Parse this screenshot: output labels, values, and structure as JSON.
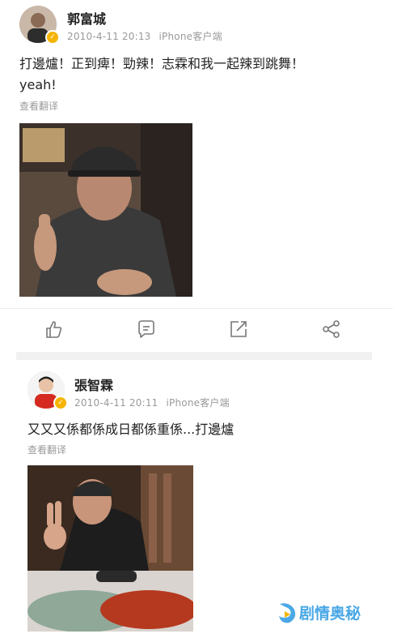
{
  "post1": {
    "author": "郭富城",
    "timestamp": "2010-4-11 20:13",
    "source": "iPhone客户端",
    "text_line1": "打邊爐！正到痺！勁辣！志霖和我一起辣到跳舞！",
    "text_line2": "yeah!",
    "translate": "查看翻译",
    "photo_icon": "photo-selfie-thumbs-up"
  },
  "toolbar": {
    "like_icon": "thumbs-up-icon",
    "comment_icon": "comment-icon",
    "repost_icon": "repost-icon",
    "share_icon": "share-icon"
  },
  "post2": {
    "author": "張智霖",
    "timestamp": "2010-4-11 20:11",
    "source": "iPhone客户端",
    "text": "又又又係都係成日都係重係...打邊爐",
    "translate": "查看翻译",
    "photo_icon": "photo-peace-sign-hotpot"
  },
  "watermark": {
    "text": "剧情奥秘"
  },
  "colors": {
    "verified": "#f6b400",
    "meta_gray": "#9a9a9a",
    "watermark_blue": "#4aa8e6"
  }
}
